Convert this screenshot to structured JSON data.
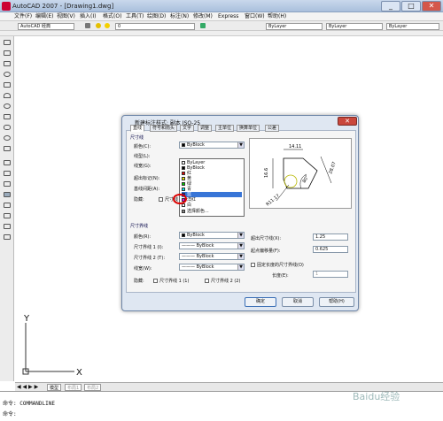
{
  "window": {
    "title": "AutoCAD 2007 - [Drawing1.dwg]",
    "min": "_",
    "max": "□",
    "close": "✕"
  },
  "menu": [
    "文件(F)",
    "编辑(E)",
    "视图(V)",
    "插入(I)",
    "格式(O)",
    "工具(T)",
    "绘图(D)",
    "标注(N)",
    "修改(M)",
    "Express",
    "窗口(W)",
    "帮助(H)"
  ],
  "toolbar": {
    "workspace": "AutoCAD 经典",
    "layer": "0",
    "color": "ByLayer",
    "linetype": "ByLayer",
    "lineweight": "ByLayer"
  },
  "tabs": [
    "模型",
    "布局1",
    "布局2"
  ],
  "command": {
    "line1": "命令: COMMANDLINE",
    "line2": "命令:"
  },
  "ucs": {
    "x": "X",
    "y": "Y"
  },
  "dialog": {
    "title": "新建标注样式: 副本 ISO-25",
    "tabs": [
      "直线",
      "符号和箭头",
      "文字",
      "调整",
      "主单位",
      "换算单位",
      "公差"
    ],
    "dim_group": "尺寸线",
    "color_label": "颜色(C):",
    "color_value": "ByBlock",
    "linetype_label": "线型(L):",
    "lineweight_label": "线宽(G):",
    "extend_label": "超出标记(N):",
    "baseline_label": "基线间距(A):",
    "suppress_label": "隐藏:",
    "suppress_opt": "尺寸线",
    "color_options": [
      "ByLayer",
      "ByBlock",
      "红",
      "黄",
      "绿",
      "青",
      "蓝",
      "洋红",
      "白",
      "选择颜色..."
    ],
    "ext_group": "尺寸界线",
    "ext_color_label": "颜色(R):",
    "ext_color_value": "ByBlock",
    "ext_lt1_label": "尺寸界线 1 (I):",
    "ext_lt1_value": "ByBlock",
    "ext_lt2_label": "尺寸界线 2 (T):",
    "ext_lt2_value": "ByBlock",
    "ext_lw_label": "线宽(W):",
    "ext_lw_value": "ByBlock",
    "ext_suppress_label": "隐藏:",
    "ext_sup1": "尺寸界线 1 (1)",
    "ext_sup2": "尺寸界线 2 (2)",
    "beyond_label": "超出尺寸线(X):",
    "beyond_value": "1.25",
    "offset_label": "起点偏移量(F):",
    "offset_value": "0.625",
    "fixed_label": "固定长度的尺寸界线(O)",
    "length_label": "长度(E):",
    "length_value": "1",
    "preview": {
      "d1": "14.11",
      "d2": "16.6",
      "d3": "28.07",
      "d4": "80°",
      "d5": "R11.17"
    },
    "ok": "确定",
    "cancel": "取消",
    "help": "帮助(H)"
  },
  "watermark": "Baidu经验",
  "accent": "#3875d7"
}
